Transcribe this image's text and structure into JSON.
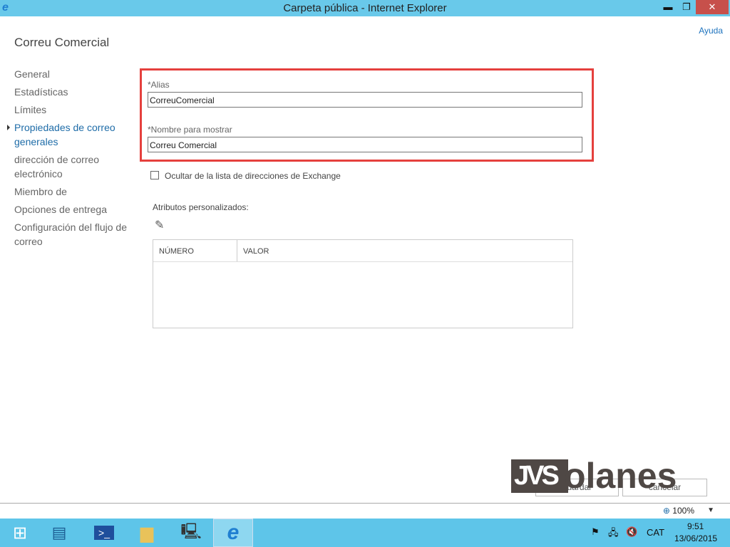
{
  "window": {
    "title": "Carpeta pública - Internet Explorer",
    "minimize": "▬",
    "restore": "❐",
    "close": "✕"
  },
  "help": "Ayuda",
  "page_title": "Correu Comercial",
  "nav": [
    {
      "label": "General"
    },
    {
      "label": "Estadísticas"
    },
    {
      "label": "Límites"
    },
    {
      "label": "Propiedades de correo generales",
      "active": true
    },
    {
      "label": "dirección de correo electrónico"
    },
    {
      "label": "Miembro de"
    },
    {
      "label": "Opciones de entrega"
    },
    {
      "label": "Configuración del flujo de correo"
    }
  ],
  "form": {
    "alias_label": "*Alias",
    "alias_value": "CorreuComercial",
    "display_label": "*Nombre para mostrar",
    "display_value": "Correu Comercial",
    "hide_label": "Ocultar de la lista de direcciones de Exchange",
    "hide_checked": false,
    "custom_attrs_label": "Atributos personalizados:",
    "edit_icon": "pencil-icon"
  },
  "table": {
    "columns": [
      "NÚMERO",
      "VALOR"
    ],
    "rows": []
  },
  "buttons": {
    "save": "guardar",
    "cancel": "cancelar"
  },
  "watermark": {
    "box": "JVS",
    "text": "olanes"
  },
  "status": {
    "zoom": "100%"
  },
  "taskbar": {
    "language": "CAT",
    "time": "9:51",
    "date": "13/06/2015"
  },
  "colors": {
    "titlebar": "#69c9ea",
    "taskbar": "#5ec5e9",
    "highlight": "#e5403d",
    "link": "#1e73be"
  }
}
